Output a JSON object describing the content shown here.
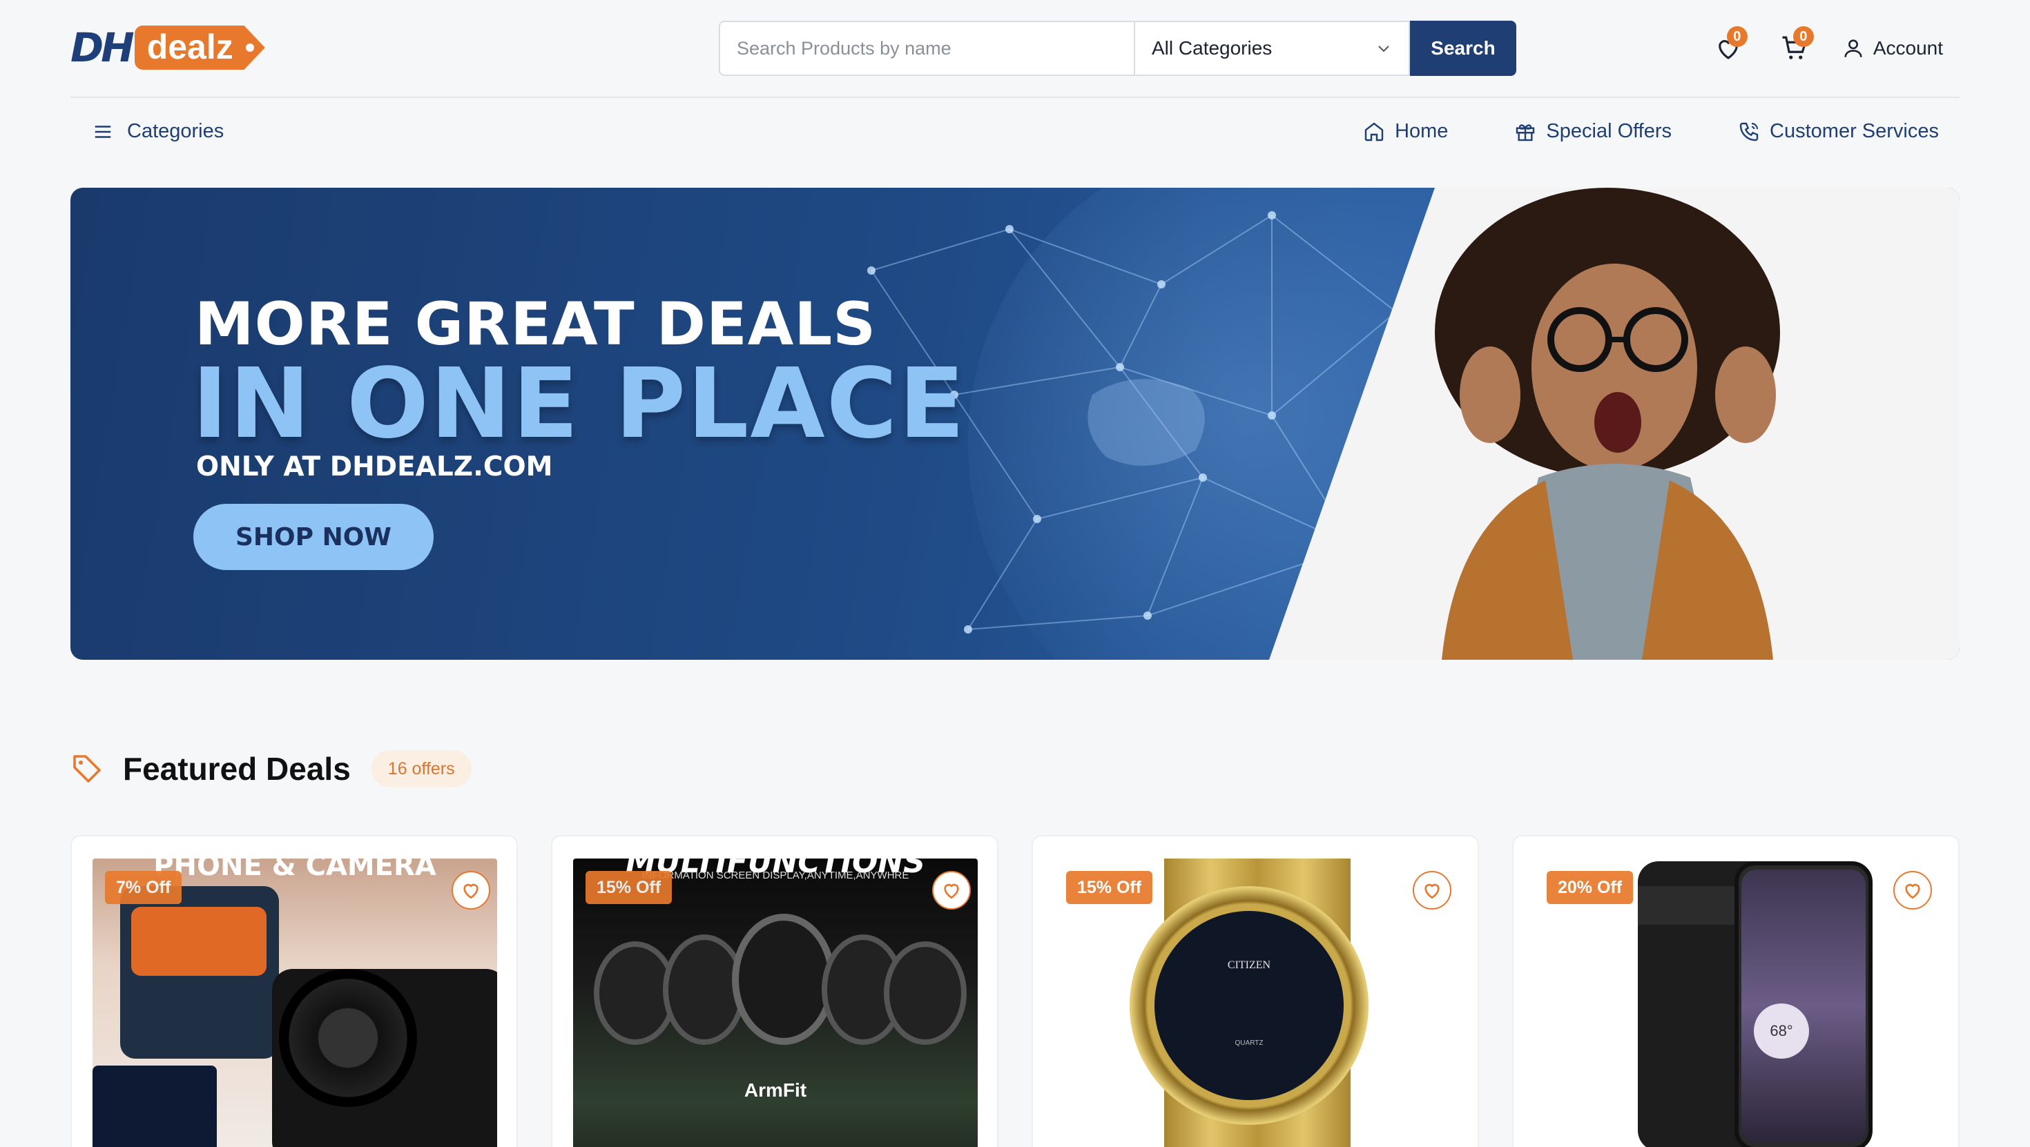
{
  "brand": {
    "mark": "DH",
    "name": "dealz"
  },
  "search": {
    "placeholder": "Search Products by name",
    "category_selected": "All Categories",
    "button_label": "Search"
  },
  "header": {
    "wishlist_count": "0",
    "cart_count": "0",
    "account_label": "Account"
  },
  "nav": {
    "categories_label": "Categories",
    "links": [
      {
        "label": "Home",
        "icon": "home-icon"
      },
      {
        "label": "Special Offers",
        "icon": "gift-icon"
      },
      {
        "label": "Customer Services",
        "icon": "phone-icon"
      }
    ]
  },
  "hero": {
    "line1": "MORE GREAT DEALS",
    "line2": "IN ONE PLACE",
    "line3": "ONLY AT DHDEALZ.COM",
    "cta": "SHOP NOW"
  },
  "featured": {
    "title": "Featured Deals",
    "count_label": "16 offers",
    "products": [
      {
        "discount": "7% Off",
        "image": "camera-microphone-kit",
        "caption": "PHONE & CAMERA"
      },
      {
        "discount": "15% Off",
        "image": "smartwatch-multifunctions",
        "caption": "MULTIFUNCTIONS",
        "subcaption": "INFORMATION SCREEN DISPLAY,ANYTIME,ANYWHRE",
        "brand": "ArmFit"
      },
      {
        "discount": "15% Off",
        "image": "gold-watch",
        "brand": "CITIZEN",
        "subcaption": "QUARTZ"
      },
      {
        "discount": "20% Off",
        "image": "smartphone",
        "caption": "68°"
      }
    ]
  },
  "colors": {
    "accent": "#e8792c",
    "navy": "#1f3f74",
    "hero_blue": "#8ec3f5"
  }
}
